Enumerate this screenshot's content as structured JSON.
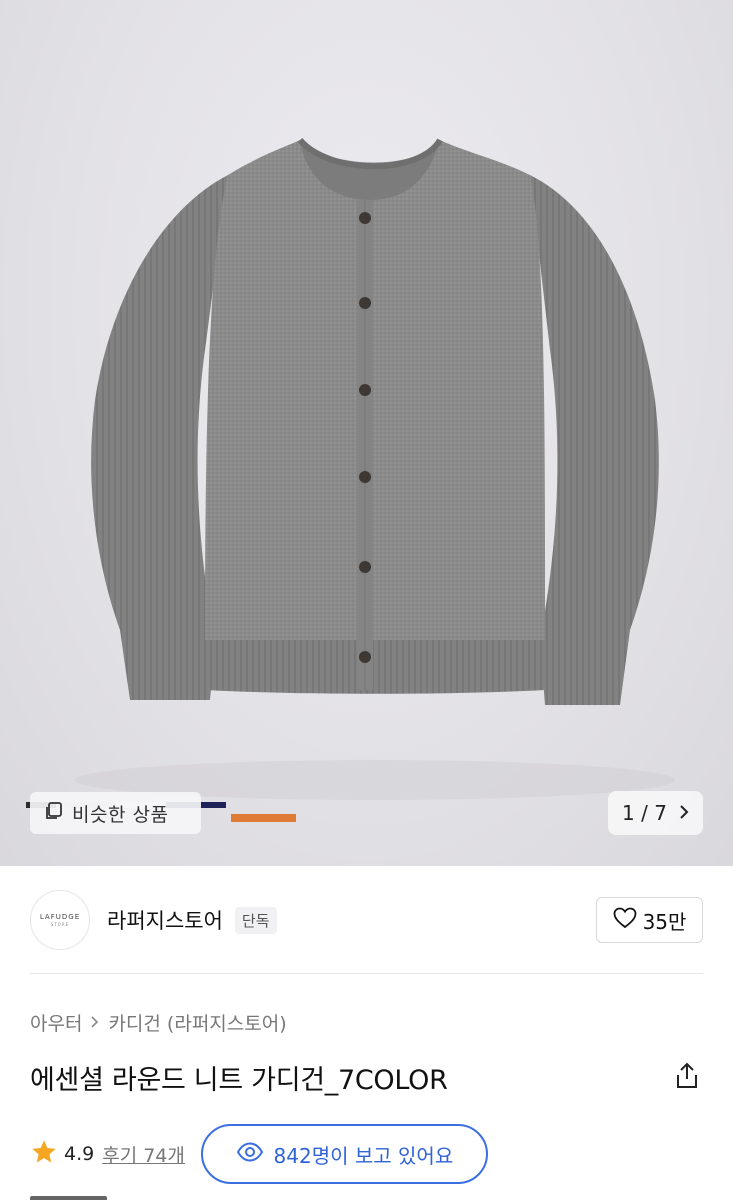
{
  "gallery": {
    "similar_label": "비슷한 상품",
    "pager_text": "1 / 7",
    "swatch_colors": [
      "#2b2b2b",
      "#cfcfcf",
      "#ffffff",
      "#1d2157",
      "#e07b35"
    ]
  },
  "store": {
    "logo_text": "LAFUDGE",
    "logo_subtext": "STORE",
    "name": "라퍼지스토어",
    "badge": "단독",
    "likes": "35만"
  },
  "product": {
    "breadcrumb": [
      "아우터",
      "카디건 (라퍼지스토어)"
    ],
    "title": "에센셜 라운드 니트 가디건_7COLOR",
    "rating": "4.9",
    "reviews": "후기 74개",
    "viewers": "842명이 보고 있어요"
  },
  "colors": {
    "accent": "#3b6fe0",
    "star": "#f5a623",
    "garment": "#8a8a8a"
  }
}
